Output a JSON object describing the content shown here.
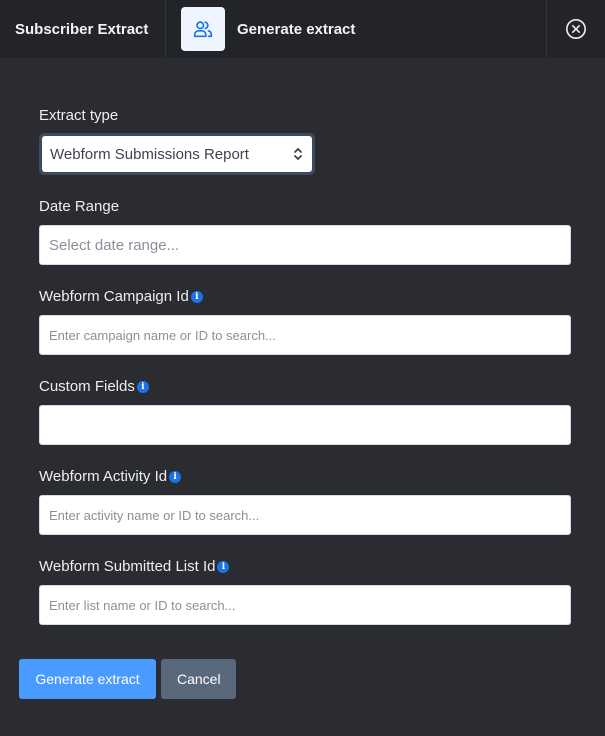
{
  "header": {
    "title": "Subscriber Extract",
    "tab_label": "Generate extract",
    "tab_icon": "users-icon",
    "close_icon": "close-circle-icon"
  },
  "form": {
    "extract_type": {
      "label": "Extract type",
      "value": "Webform Submissions Report"
    },
    "date_range": {
      "label": "Date Range",
      "placeholder": "Select date range..."
    },
    "campaign_id": {
      "label": "Webform Campaign Id",
      "placeholder": "Enter campaign name or ID to search..."
    },
    "custom_fields": {
      "label": "Custom Fields",
      "placeholder": ""
    },
    "activity_id": {
      "label": "Webform Activity Id",
      "placeholder": "Enter activity name or ID to search..."
    },
    "submitted_list_id": {
      "label": "Webform Submitted List Id",
      "placeholder": "Enter list name or ID to search..."
    },
    "info_glyph": "i"
  },
  "buttons": {
    "generate": "Generate extract",
    "cancel": "Cancel"
  },
  "colors": {
    "primary": "#4a9bff",
    "secondary": "#5a687c",
    "info": "#1a73e8",
    "background": "#2a2c31",
    "header": "#222429"
  }
}
